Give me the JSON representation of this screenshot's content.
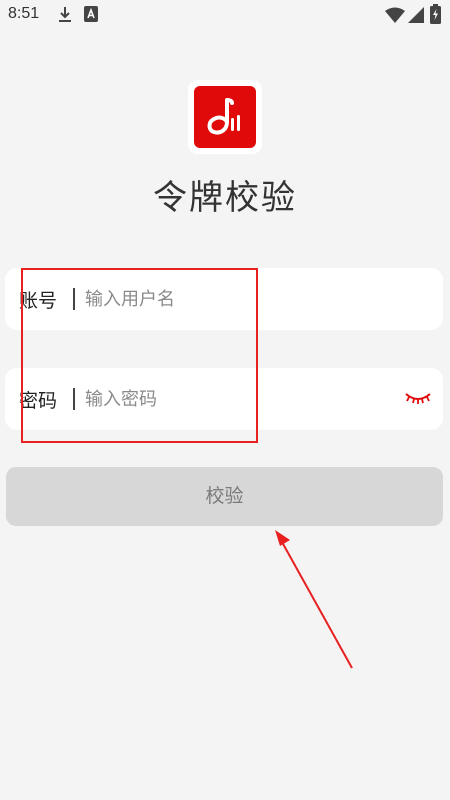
{
  "status_bar": {
    "time": "8:51"
  },
  "app": {
    "title": "令牌校验",
    "brand_color": "#e00a0a"
  },
  "form": {
    "account": {
      "label": "账号",
      "placeholder": "输入用户名",
      "value": ""
    },
    "password": {
      "label": "密码",
      "placeholder": "输入密码",
      "value": "",
      "toggle_icon": "eye-closed-icon"
    },
    "submit_label": "校验",
    "submit_enabled": false
  },
  "annotation": {
    "color": "#e82020"
  }
}
